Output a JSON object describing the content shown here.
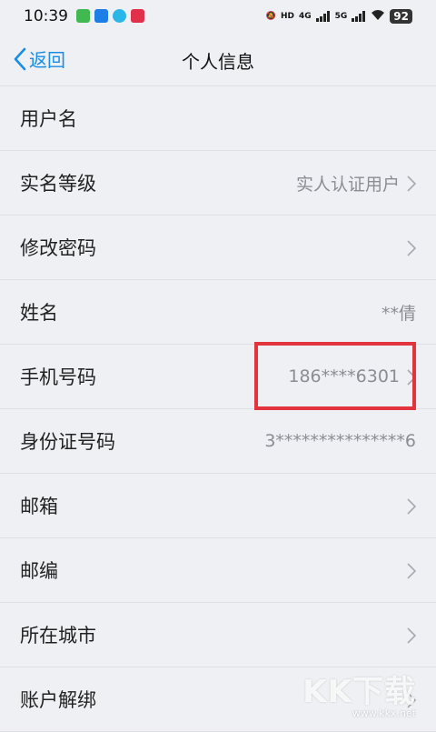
{
  "status_bar": {
    "time": "10:39",
    "signal_tags": [
      "HD",
      "4G",
      "5G"
    ],
    "battery": "92"
  },
  "nav": {
    "back_label": "返回",
    "title": "个人信息"
  },
  "rows": [
    {
      "label": "用户名",
      "value": "",
      "arrow": false
    },
    {
      "label": "实名等级",
      "value": "实人认证用户",
      "arrow": true
    },
    {
      "label": "修改密码",
      "value": "",
      "arrow": true
    },
    {
      "label": "姓名",
      "value": "**倩",
      "arrow": false
    },
    {
      "label": "手机号码",
      "value": "186****6301",
      "arrow": true
    },
    {
      "label": "身份证号码",
      "value": "3***************6",
      "arrow": false
    },
    {
      "label": "邮箱",
      "value": "",
      "arrow": true
    },
    {
      "label": "邮编",
      "value": "",
      "arrow": true
    },
    {
      "label": "所在城市",
      "value": "",
      "arrow": true
    },
    {
      "label": "账户解绑",
      "value": "",
      "arrow": true
    }
  ],
  "watermark": {
    "logo": "KK下载",
    "url": "www.kkx.net"
  },
  "colors": {
    "accent": "#1a8ce3",
    "highlight": "#e2343c",
    "background": "#eef0f4"
  }
}
